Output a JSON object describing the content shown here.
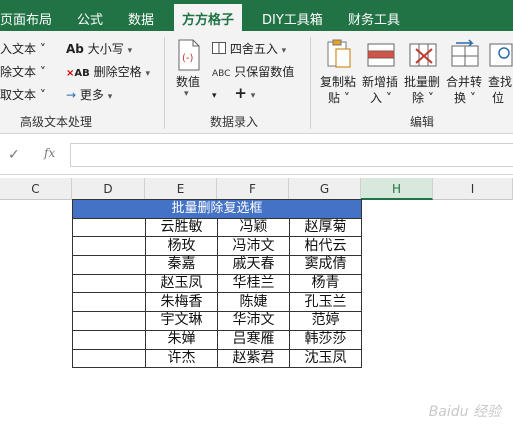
{
  "tabs": [
    "页面布局",
    "公式",
    "数据",
    "方方格子",
    "DIY工具箱",
    "财务工具"
  ],
  "ribbon": {
    "text_group": {
      "items": [
        "入文本 ˅",
        "除文本 ˅",
        "取文本 ˅"
      ],
      "size_label": "大小写",
      "remove_space_label": "删除空格",
      "more_label": "更多",
      "group_label": "高级文本处理"
    },
    "number_group": {
      "numeric_label": "数值",
      "round_label": "四舍五入",
      "keep_number_label": "只保留数值",
      "group_label": "数据录入"
    },
    "edit_group": {
      "buttons": [
        {
          "line1": "复制粘",
          "line2": "贴 ˅"
        },
        {
          "line1": "新增插",
          "line2": "入 ˅"
        },
        {
          "line1": "批量删",
          "line2": "除 ˅"
        },
        {
          "line1": "合并转",
          "line2": "换 ˅"
        },
        {
          "line1": "查找",
          "line2": "位"
        }
      ],
      "group_label": "编辑"
    }
  },
  "formula_bar": {
    "fx": "fx"
  },
  "columns": [
    "C",
    "D",
    "E",
    "F",
    "G",
    "H",
    "I"
  ],
  "table": {
    "title": "批量删除复选框",
    "rows": [
      [
        "",
        "云胜敏",
        "冯颖",
        "赵厚菊"
      ],
      [
        "",
        "杨玫",
        "冯沛文",
        "柏代云"
      ],
      [
        "",
        "秦嘉",
        "戚天春",
        "窦成倩"
      ],
      [
        "",
        "赵玉凤",
        "华桂兰",
        "杨青"
      ],
      [
        "",
        "朱梅香",
        "陈婕",
        "孔玉兰"
      ],
      [
        "",
        "宇文琳",
        "华沛文",
        "范婷"
      ],
      [
        "",
        "朱婵",
        "吕寒雁",
        "韩莎莎"
      ],
      [
        "",
        "许杰",
        "赵紫君",
        "沈玉凤"
      ]
    ]
  },
  "watermark": "Baidu 经验"
}
